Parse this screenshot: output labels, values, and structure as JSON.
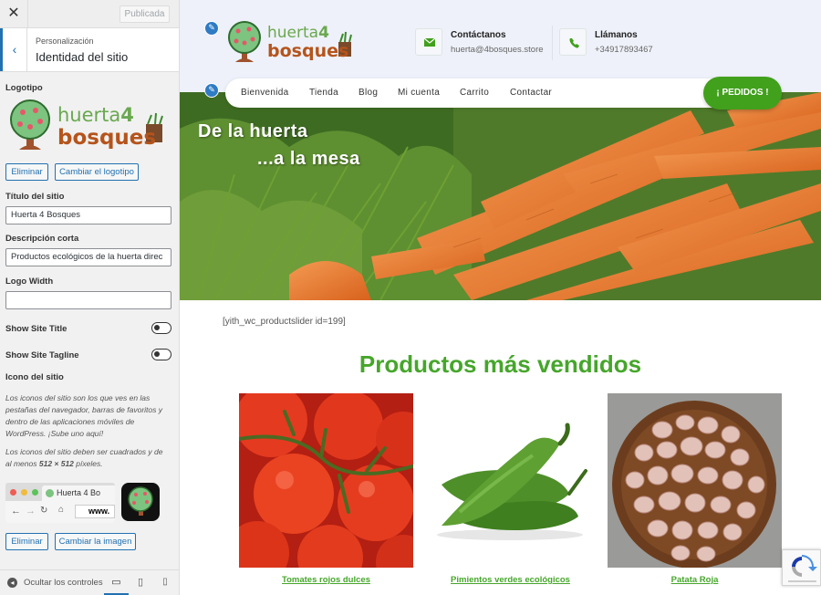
{
  "customizer": {
    "close_label": "✕",
    "publish_label": "Publicada",
    "breadcrumb": "Personalización",
    "section_title": "Identidad del sitio",
    "logo_label": "Logotipo",
    "remove_logo": "Eliminar",
    "change_logo": "Cambiar el logotipo",
    "site_title_label": "Título del sitio",
    "site_title_value": "Huerta 4 Bosques",
    "tagline_label": "Descripción corta",
    "tagline_value": "Productos ecológicos de la huerta direc",
    "logo_width_label": "Logo Width",
    "logo_width_value": "",
    "show_title_label": "Show Site Title",
    "show_tagline_label": "Show Site Tagline",
    "site_icon_label": "Icono del sitio",
    "site_icon_desc_1": "Los iconos del sitio son los que ves en las pestañas del navegador, barras de favoritos y dentro de las aplicaciones móviles de WordPress. ¡Sube uno aquí!",
    "site_icon_desc_2_prefix": "Los iconos del sitio deben ser cuadrados y de al menos ",
    "site_icon_desc_2_bold": "512 × 512",
    "site_icon_desc_2_suffix": " píxeles.",
    "browser_tab_label": "Huerta 4 Bo",
    "browser_url": "www.",
    "remove_icon": "Eliminar",
    "change_icon": "Cambiar la imagen",
    "hide_controls": "Ocultar los controles"
  },
  "logo": {
    "word1": "huerta",
    "word1_num": "4",
    "word2": "bosques"
  },
  "header": {
    "contact_title": "Contáctanos",
    "contact_email": "huerta@4bosques.store",
    "call_title": "Llámanos",
    "call_phone": "+34917893467"
  },
  "nav": {
    "items": [
      "Bienvenida",
      "Tienda",
      "Blog",
      "Mi cuenta",
      "Carrito",
      "Contactar"
    ],
    "order_button": "¡ PEDIDOS !"
  },
  "hero": {
    "line1": "De la huerta",
    "line2": "...a la mesa"
  },
  "main": {
    "shortcode": "[yith_wc_productslider id=199]",
    "section_title": "Productos más vendidos",
    "products": [
      {
        "name": "Tomates rojos dulces"
      },
      {
        "name": "Pimientos verdes ecológicos"
      },
      {
        "name": "Patata Roja"
      }
    ]
  },
  "colors": {
    "brand_green": "#41a01c",
    "logo_green": "#6aa84f",
    "logo_brown": "#b5541c",
    "wp_blue": "#2271b1"
  }
}
